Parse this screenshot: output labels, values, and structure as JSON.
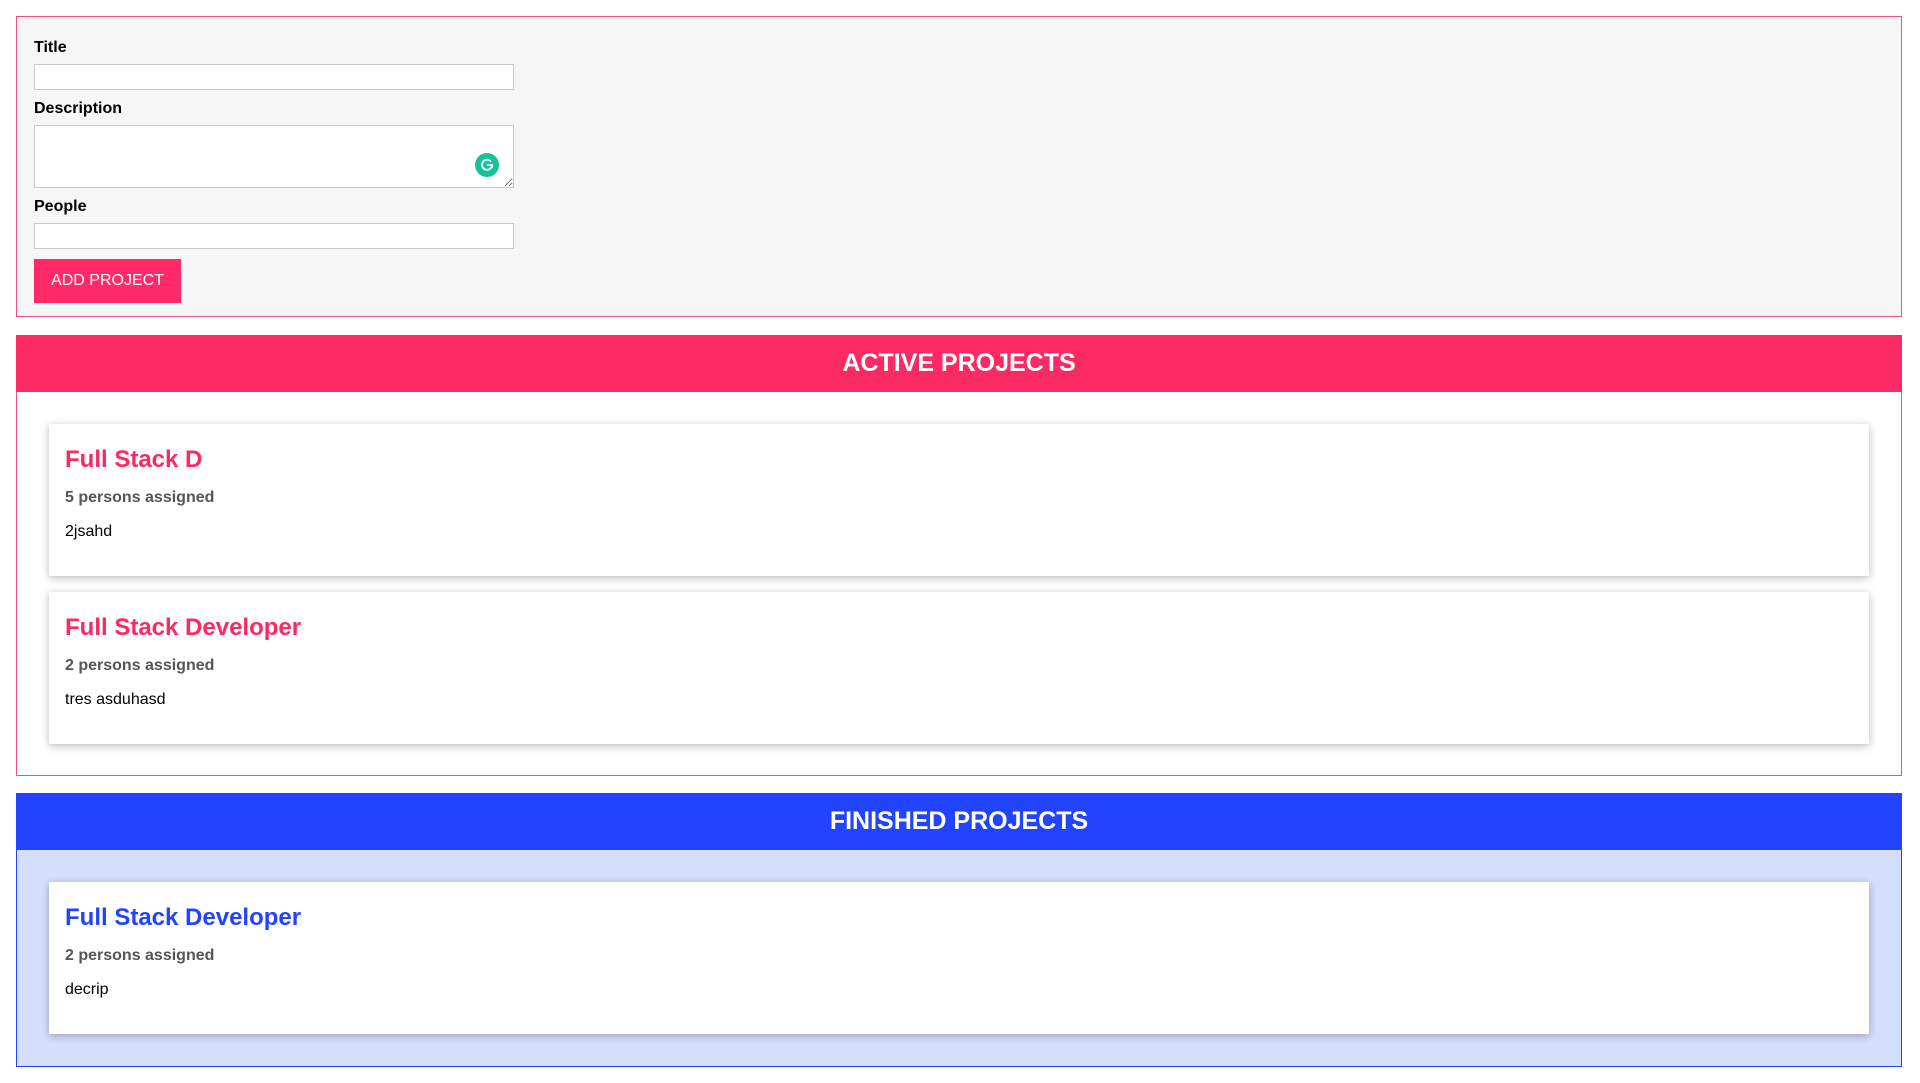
{
  "form": {
    "title_label": "Title",
    "title_value": "",
    "description_label": "Description",
    "description_value": "",
    "people_label": "People",
    "people_value": "",
    "submit_label": "ADD PROJECT"
  },
  "active": {
    "heading": "ACTIVE PROJECTS",
    "accent_color": "#fc2a64",
    "projects": [
      {
        "title": "Full Stack D",
        "people": "5 persons assigned",
        "description": "2jsahd"
      },
      {
        "title": "Full Stack Developer",
        "people": "2 persons assigned",
        "description": "tres asduhasd"
      }
    ]
  },
  "finished": {
    "heading": "FINISHED PROJECTS",
    "accent_color": "#2244ff",
    "projects": [
      {
        "title": "Full Stack Developer",
        "people": "2 persons assigned",
        "description": "decrip"
      }
    ]
  },
  "icons": {
    "grammarly": "grammarly-icon"
  }
}
